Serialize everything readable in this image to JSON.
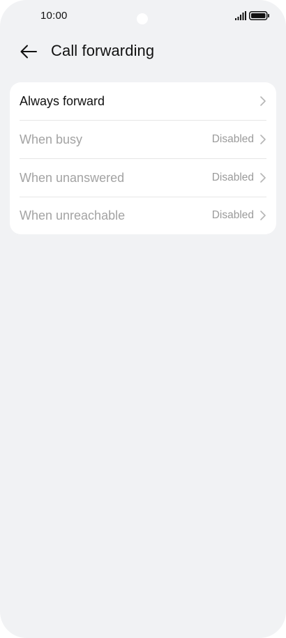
{
  "status_bar": {
    "time": "10:00",
    "signal_icon": "signal-bars-icon",
    "battery_icon": "battery-icon"
  },
  "header": {
    "back_icon": "arrow-left-icon",
    "title": "Call forwarding"
  },
  "forwarding_options": [
    {
      "label": "Always forward",
      "value": "",
      "enabled": true
    },
    {
      "label": "When busy",
      "value": "Disabled",
      "enabled": false
    },
    {
      "label": "When unanswered",
      "value": "Disabled",
      "enabled": false
    },
    {
      "label": "When unreachable",
      "value": "Disabled",
      "enabled": false
    }
  ],
  "colors": {
    "background": "#f1f2f4",
    "card": "#ffffff",
    "text_primary": "#111111",
    "text_disabled": "#a3a3a3",
    "value_text": "#9a9a9a"
  }
}
